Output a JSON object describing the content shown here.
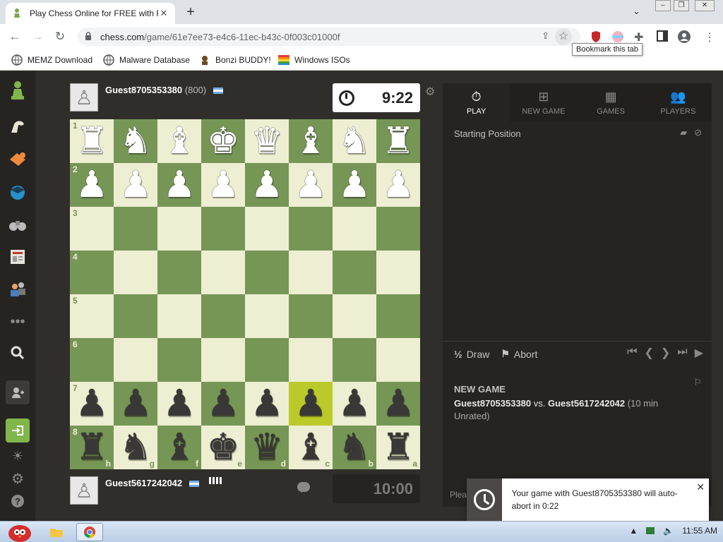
{
  "browser": {
    "tab_title": "Play Chess Online for FREE with F",
    "new_tab": "+",
    "url_host": "chess.com",
    "url_path": "/game/61e7ee73-e4c6-11ec-b43c-0f003c01000f",
    "tooltip": "Bookmark this tab",
    "bookmarks": [
      {
        "label": "MEMZ Download",
        "icon": "globe-icon"
      },
      {
        "label": "Malware Database",
        "icon": "globe-icon"
      },
      {
        "label": "Bonzi BUDDY!",
        "icon": "bonzi-icon"
      },
      {
        "label": "Windows ISOs",
        "icon": "windows-flag-icon"
      }
    ]
  },
  "players": {
    "top": {
      "name": "Guest8705353380",
      "rating": "(800)",
      "clock": "9:22"
    },
    "bottom": {
      "name": "Guest5617242042",
      "clock": "10:00"
    }
  },
  "board": {
    "ranks": [
      "1",
      "2",
      "3",
      "4",
      "5",
      "6",
      "7",
      "8"
    ],
    "files": [
      "h",
      "g",
      "f",
      "e",
      "d",
      "c",
      "b",
      "a"
    ],
    "rows": [
      [
        "wR",
        "wN",
        "wB",
        "wK",
        "wQ",
        "wB",
        "wN",
        "wR"
      ],
      [
        "wP",
        "wP",
        "wP",
        "wP",
        "wP",
        "wP",
        "wP",
        "wP"
      ],
      [
        "",
        "",
        "",
        "",
        "",
        "",
        "",
        ""
      ],
      [
        "",
        "",
        "",
        "",
        "",
        "",
        "",
        ""
      ],
      [
        "",
        "",
        "",
        "",
        "",
        "",
        "",
        ""
      ],
      [
        "",
        "",
        "",
        "",
        "",
        "",
        "",
        ""
      ],
      [
        "bP",
        "bP",
        "bP",
        "bP",
        "bP",
        "bP",
        "bP",
        "bP"
      ],
      [
        "bR",
        "bN",
        "bB",
        "bK",
        "bQ",
        "bB",
        "bN",
        "bR"
      ]
    ],
    "highlight": [
      6,
      5
    ],
    "colors": {
      "light": "#eeeed2",
      "dark": "#769656",
      "highlight": "#baca2b"
    }
  },
  "panel": {
    "tabs": [
      {
        "label": "PLAY",
        "icon": "stopwatch-icon",
        "active": true
      },
      {
        "label": "NEW GAME",
        "icon": "plus-square-icon",
        "active": false
      },
      {
        "label": "GAMES",
        "icon": "board-icon",
        "active": false
      },
      {
        "label": "PLAYERS",
        "icon": "players-icon",
        "active": false
      }
    ],
    "opening": "Starting Position",
    "draw_label": "Draw",
    "draw_icon": "½",
    "abort_label": "Abort",
    "game_title": "NEW GAME",
    "player1": "Guest8705353380",
    "vs": " vs. ",
    "player2": "Guest5617242042",
    "game_meta": "(10 min Unrated)",
    "plea": "Plea"
  },
  "toast": {
    "message": "Your game with Guest8705353380 will auto-abort in 0:22"
  },
  "taskbar": {
    "time": "11:55 AM"
  }
}
